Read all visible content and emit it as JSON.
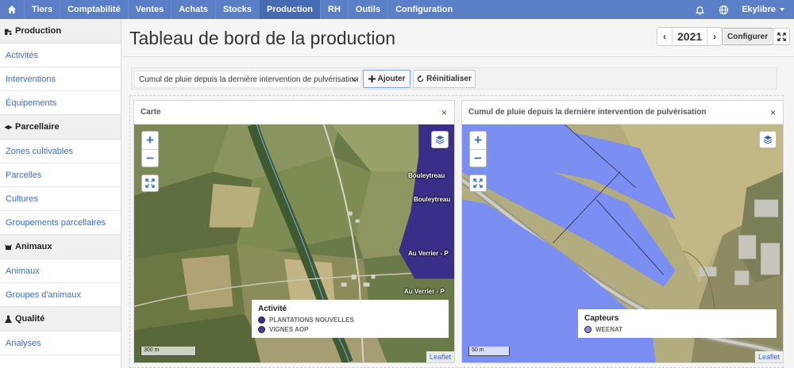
{
  "topnav": {
    "items": [
      "Tiers",
      "Comptabilité",
      "Ventes",
      "Achats",
      "Stocks",
      "Production",
      "RH",
      "Outils",
      "Configuration"
    ],
    "active": "Production",
    "user": "Ekylibre"
  },
  "sidebar": {
    "sections": [
      {
        "title": "Production",
        "links": [
          "Activités",
          "Interventions",
          "Équipements"
        ]
      },
      {
        "title": "Parcellaire",
        "links": [
          "Zones cultivables",
          "Parcelles",
          "Cultures",
          "Groupements parcellaires"
        ]
      },
      {
        "title": "Animaux",
        "links": [
          "Animaux",
          "Groupes d'animaux"
        ]
      },
      {
        "title": "Qualité",
        "links": [
          "Analyses"
        ]
      }
    ]
  },
  "header": {
    "title": "Tableau de bord de la production",
    "year": "2021",
    "configure_label": "Configurer"
  },
  "toolbar": {
    "select_value": "Cumul de pluie depuis la dernière intervention de pulvérisation",
    "add_label": "Ajouter",
    "reset_label": "Réinitialiser"
  },
  "panels": {
    "left": {
      "title": "Carte",
      "close": "×",
      "legend_title": "Activité",
      "legend_items": [
        {
          "label": "PLANTATIONS NOUVELLES",
          "color": "#3a3290"
        },
        {
          "label": "VIGNES AOP",
          "color": "#4b3b9b"
        }
      ],
      "map_labels": [
        "Bouleytreau",
        "Bouleytreau",
        "Au Verrier - P",
        "Au Verrier - P"
      ],
      "scale": "300 m",
      "attribution": "Leaflet"
    },
    "right": {
      "title": "Cumul de pluie depuis la dernière intervention de pulvérisation",
      "close": "×",
      "legend_title": "Capteurs",
      "legend_items": [
        {
          "label": "WEENAT",
          "color": "#8a8ae0"
        }
      ],
      "scale": "50 m",
      "attribution": "Leaflet"
    }
  },
  "colors": {
    "nav": "#5b7fc7",
    "link": "#3a6fc4",
    "map_fill": "#7b8ef2"
  }
}
